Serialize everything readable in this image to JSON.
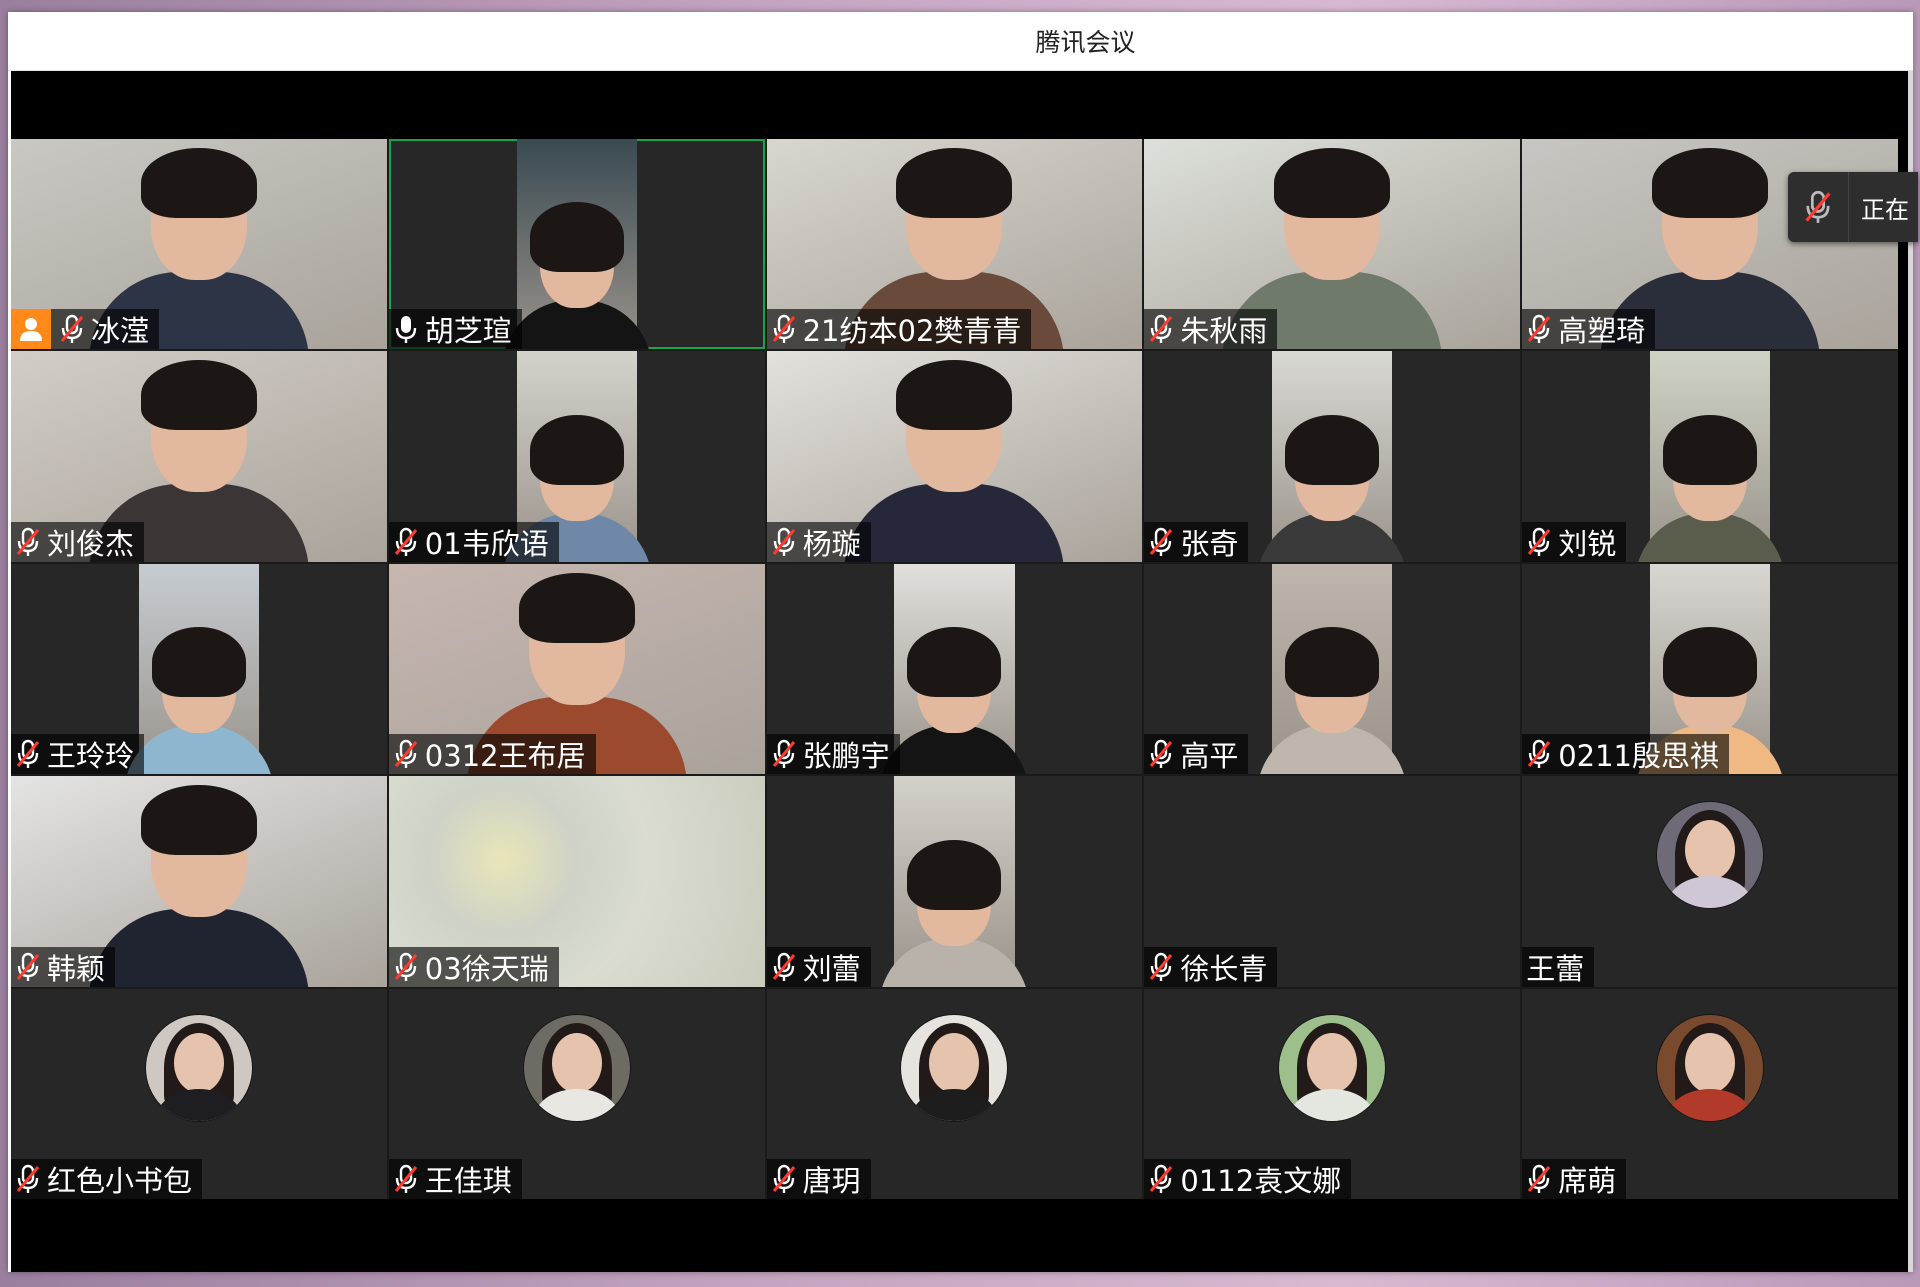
{
  "window": {
    "title": "腾讯会议"
  },
  "toast": {
    "text": "正在"
  },
  "participants": [
    {
      "name": "冰滢",
      "host": true,
      "muted": true,
      "kind": "cam",
      "bg": "#c9c8c3",
      "shirt": "#2c3446"
    },
    {
      "name": "胡芝瑄",
      "muted": false,
      "active": true,
      "kind": "pillar",
      "bg": "#3a4a52",
      "shirt": "#141414"
    },
    {
      "name": "21纺本02樊青青",
      "muted": true,
      "kind": "cam",
      "bg": "#d9d6cf",
      "shirt": "#6a4a3a"
    },
    {
      "name": "朱秋雨",
      "muted": true,
      "kind": "cam",
      "bg": "#dde0da",
      "shirt": "#6f7a6a"
    },
    {
      "name": "高塑琦",
      "muted": true,
      "kind": "cam",
      "bg": "#c8c6c2",
      "shirt": "#2a2e3a"
    },
    {
      "name": "刘俊杰",
      "muted": true,
      "kind": "cam",
      "bg": "#d2cdc6",
      "shirt": "#3b3536"
    },
    {
      "name": "01韦欣语",
      "muted": true,
      "kind": "pillar",
      "bg": "#d4d2cc",
      "shirt": "#6f88a8"
    },
    {
      "name": "杨璇",
      "muted": true,
      "kind": "cam",
      "bg": "#e4e0dc",
      "shirt": "#26283a"
    },
    {
      "name": "张奇",
      "muted": true,
      "kind": "pillar",
      "bg": "#d9d9d4",
      "shirt": "#3a3a3a"
    },
    {
      "name": "刘锐",
      "muted": true,
      "kind": "pillar",
      "bg": "#cfd3c6",
      "shirt": "#5b5d4c"
    },
    {
      "name": "王玲玲",
      "muted": true,
      "kind": "pillar",
      "bg": "#c6ccd2",
      "shirt": "#8fb6cf"
    },
    {
      "name": "0312王布居",
      "muted": true,
      "kind": "cam",
      "bg": "#c7b6b0",
      "shirt": "#9c4a2e"
    },
    {
      "name": "张鹏宇",
      "muted": true,
      "kind": "pillar",
      "bg": "#e1e0dc",
      "shirt": "#141414"
    },
    {
      "name": "高平",
      "muted": true,
      "kind": "pillar",
      "bg": "#bfb7ad",
      "shirt": "#bfb7ad"
    },
    {
      "name": "0211殷思祺",
      "muted": true,
      "kind": "pillar",
      "bg": "#d8d7d2",
      "shirt": "#f0b882"
    },
    {
      "name": "韩颖",
      "muted": true,
      "kind": "cam",
      "bg": "#e4e4e4",
      "shirt": "#202431"
    },
    {
      "name": "03徐天瑞",
      "muted": true,
      "kind": "blur",
      "bg": "#d6d8c4",
      "shirt": "#d6d8c4"
    },
    {
      "name": "刘蕾",
      "muted": true,
      "kind": "pillar",
      "bg": "#d4d0ca",
      "shirt": "#b8b2aa"
    },
    {
      "name": "徐长青",
      "muted": true,
      "kind": "empty",
      "bg": "#2a2a2a",
      "shirt": "#2a2a2a"
    },
    {
      "name": "王蕾",
      "muted": false,
      "nomic": true,
      "kind": "avatar",
      "bg": "#6f6a78",
      "shirt": "#cfc6d6"
    },
    {
      "name": "红色小书包",
      "muted": true,
      "kind": "avatar",
      "bg": "#cfc7c2",
      "shirt": "#1d1d22"
    },
    {
      "name": "王佳琪",
      "muted": true,
      "kind": "avatar",
      "bg": "#6e6a64",
      "shirt": "#e9e7e2"
    },
    {
      "name": "唐玥",
      "muted": true,
      "kind": "avatar",
      "bg": "#e7e3df",
      "shirt": "#1d1d1d"
    },
    {
      "name": "0112袁文娜",
      "muted": true,
      "kind": "avatar",
      "bg": "#9dbf8c",
      "shirt": "#e3e7e0"
    },
    {
      "name": "席萌",
      "muted": true,
      "kind": "avatar",
      "bg": "#7a4a2e",
      "shirt": "#b23a2a"
    }
  ],
  "icons": {
    "mic_muted": "mic-muted-icon",
    "mic_on": "mic-icon",
    "host": "host-icon"
  }
}
